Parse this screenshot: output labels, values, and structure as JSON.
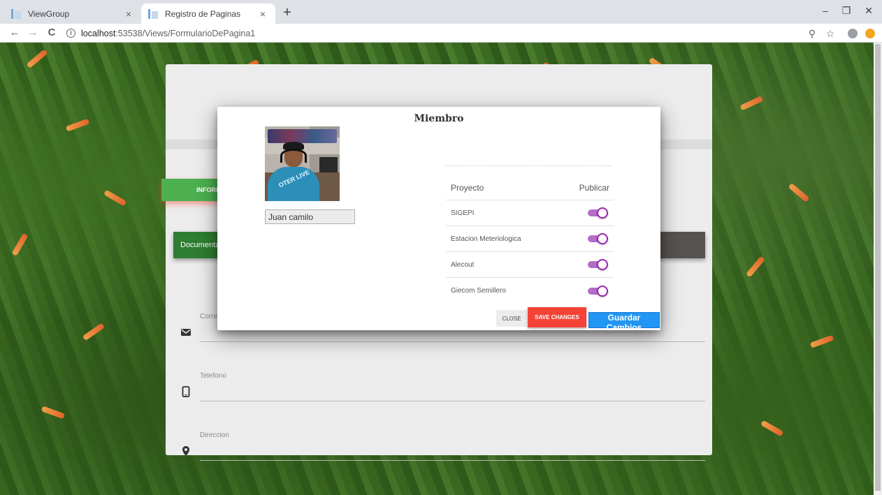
{
  "browser": {
    "tabs": [
      {
        "title": "ViewGroup",
        "close": "×"
      },
      {
        "title": "Registro de Paginas",
        "close": "×"
      }
    ],
    "new_tab": "+",
    "window_controls": {
      "minimize": "–",
      "restore": "❐",
      "close": "✕"
    },
    "address": {
      "host": "localhost",
      "path": ":53538/Views/FormularioDePagina1"
    },
    "nav": {
      "back": "←",
      "forward": "→",
      "reload": "C"
    },
    "icons": {
      "info": "i",
      "zoom": "⚲",
      "bookmark": "☆"
    }
  },
  "form": {
    "info_tab": "INFORI",
    "doc_bar": "Documentac",
    "fields": [
      {
        "label": "Corre",
        "icon": "email-icon"
      },
      {
        "label": "Telefono",
        "icon": "phone-icon"
      },
      {
        "label": "Direccion",
        "icon": "location-icon"
      }
    ]
  },
  "modal": {
    "title": "Miembro",
    "avatar_text": "OTER LIVE",
    "name_value": "Juan camilo",
    "table": {
      "col_project": "Proyecto",
      "col_publish": "Publicar",
      "rows": [
        {
          "name": "SIGEPI",
          "published": true
        },
        {
          "name": "Estacion Meteriologica",
          "published": true
        },
        {
          "name": "Alecout",
          "published": true
        },
        {
          "name": "Giecom Semillero",
          "published": true
        }
      ]
    },
    "buttons": {
      "close": "CLOSE",
      "save": "SAVE CHANGES",
      "guardar": "Guardar Cambios"
    }
  },
  "colors": {
    "toggle_on": "#9c27b0",
    "save_button": "#f44336",
    "guardar_button": "#2196f3",
    "info_tab": "#4caf50"
  }
}
